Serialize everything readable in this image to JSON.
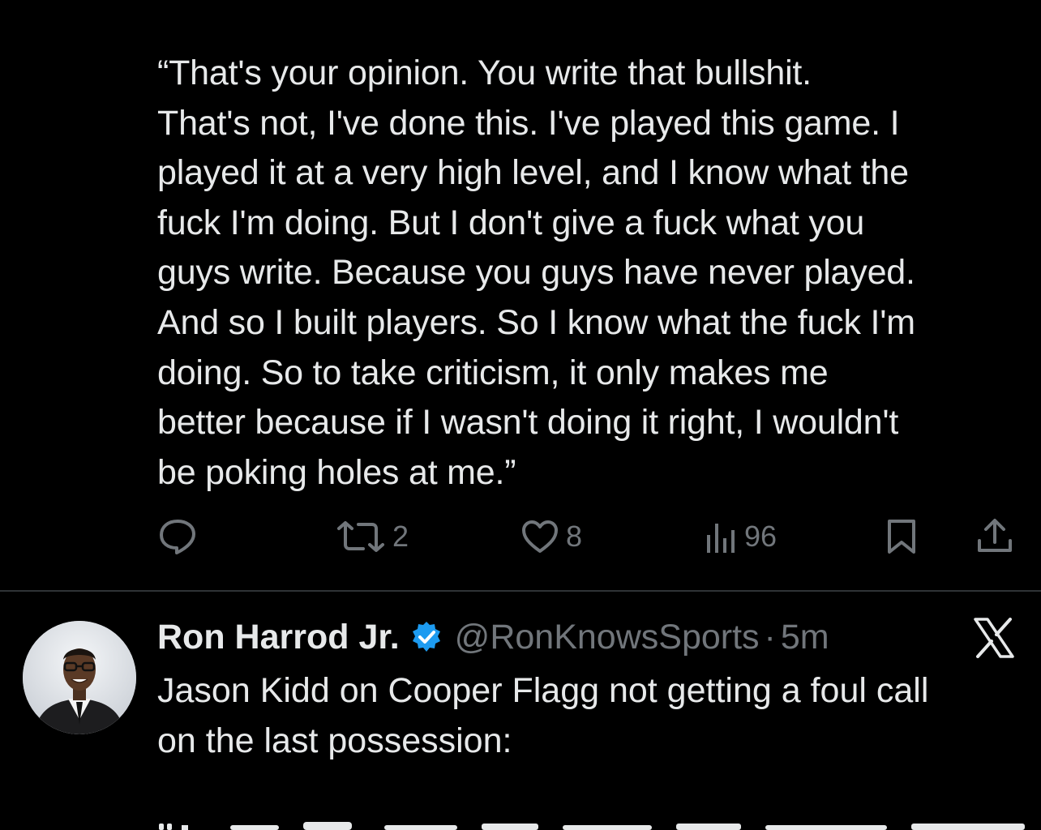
{
  "tweet_quote": {
    "lines": [
      "“That's your opinion. You write that bullshit.",
      "That's not, I've done this. I've played this game. I",
      "played it at a very high level, and I know what the",
      "fuck I'm doing. But I don't give a fuck what you",
      "guys write. Because you guys have never played.",
      "And so I built players. So I know what the fuck I'm",
      "doing. So to take criticism, it only makes me",
      "better because if I wasn't doing it right, I wouldn't",
      "be poking holes at me.”"
    ],
    "actions": {
      "reply_icon": "reply-bubble-icon",
      "retweet_icon": "retweet-icon",
      "retweet_count": "2",
      "like_icon": "heart-icon",
      "like_count": "8",
      "views_icon": "views-bar-chart-icon",
      "views_count": "96",
      "bookmark_icon": "bookmark-icon",
      "share_icon": "share-upload-icon"
    }
  },
  "tweet_next": {
    "display_name": "Ron Harrod Jr.",
    "verified_icon": "verified-badge-icon",
    "handle": "@RonKnowsSports",
    "separator": "·",
    "timestamp": "5m",
    "platform_logo": "x-logo-icon",
    "body_lines": [
      "Jason Kidd on Cooper Flagg not getting a foul call",
      "on the last possession:"
    ]
  },
  "colors": {
    "background": "#000000",
    "text_primary": "#e7e9ea",
    "text_secondary": "#71767b",
    "divider": "#2f3336",
    "verified": "#1d9bf0"
  }
}
